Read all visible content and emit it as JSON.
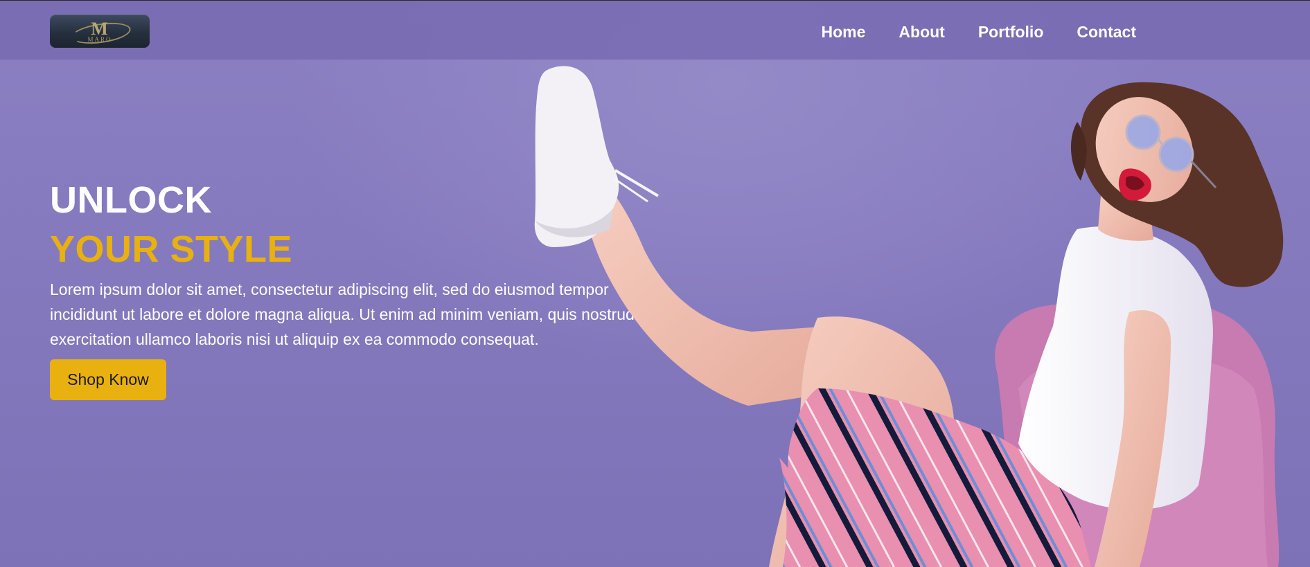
{
  "header": {
    "logo_text": "MARO",
    "nav": [
      {
        "label": "Home"
      },
      {
        "label": "About"
      },
      {
        "label": "Portfolio"
      },
      {
        "label": "Contact"
      }
    ]
  },
  "hero": {
    "title_line1": "UNLOCK",
    "title_line2": "YOUR STYLE",
    "description": "Lorem ipsum dolor sit amet, consectetur adipiscing elit, sed do eiusmod tempor incididunt ut labore et dolore magna aliqua. Ut enim ad minim veniam, quis nostrud exercitation ullamco laboris nisi ut aliquip ex ea commodo consequat.",
    "cta_label": "Shop Know",
    "image": "smiling-woman-raising-leg-sneakers-photo"
  },
  "colors": {
    "background": "#8478bd",
    "accent": "#e9b10f",
    "text": "#ffffff"
  }
}
